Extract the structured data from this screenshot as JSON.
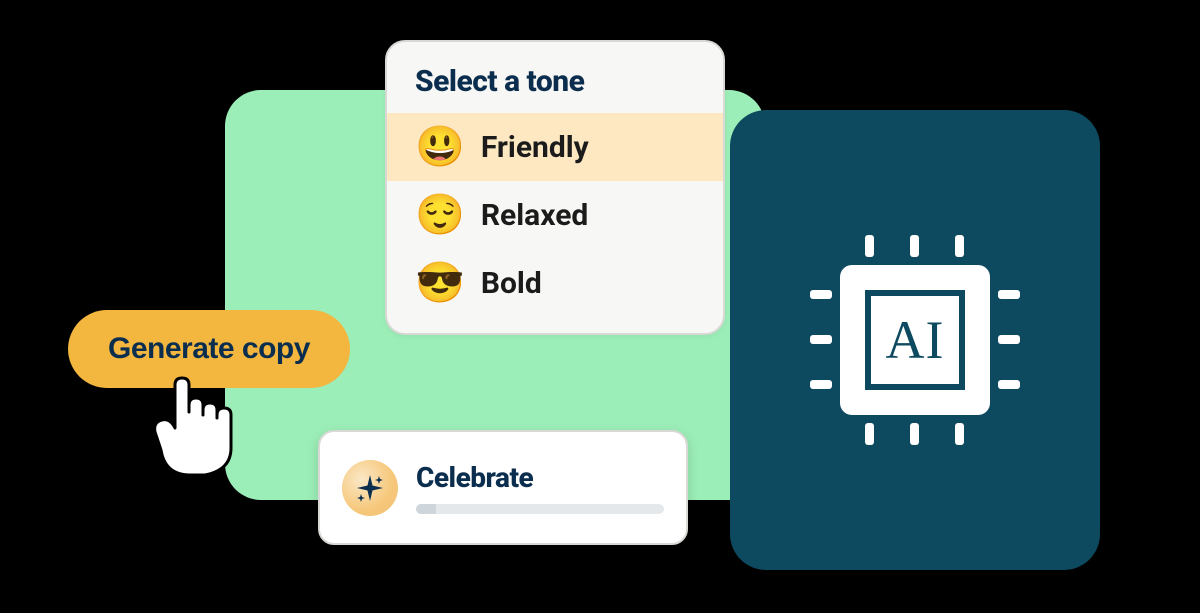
{
  "colors": {
    "green_bg": "#9ceeb8",
    "teal_panel": "#0d4a5f",
    "button_bg": "#f3b63f",
    "title_color": "#0b2e4f",
    "tone_active_bg": "#fde8c2"
  },
  "generate_button": {
    "label": "Generate copy"
  },
  "tone_panel": {
    "title": "Select a tone",
    "items": [
      {
        "emoji": "😃",
        "label": "Friendly",
        "active": true
      },
      {
        "emoji": "😌",
        "label": "Relaxed",
        "active": false
      },
      {
        "emoji": "😎",
        "label": "Bold",
        "active": false
      }
    ]
  },
  "celebrate_card": {
    "title": "Celebrate",
    "icon": "sparkle-icon"
  },
  "ai_panel": {
    "label": "AI",
    "icon": "chip-icon"
  }
}
